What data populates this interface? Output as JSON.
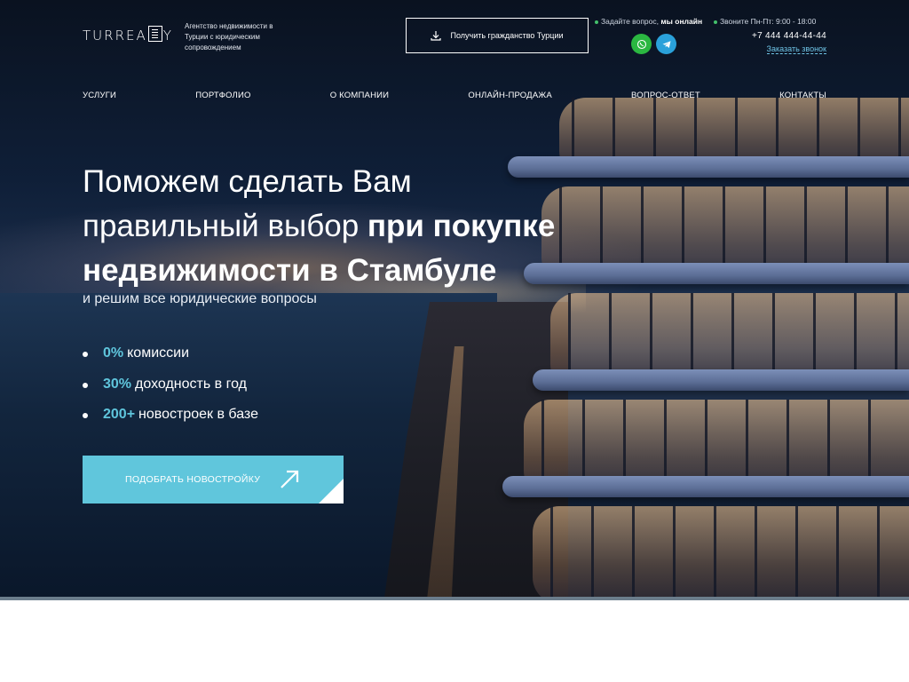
{
  "brand": {
    "logo_left": "TURREA",
    "logo_right": "Y",
    "tagline": "Агентство недвижимости в Турции с юридическим сопровождением"
  },
  "header": {
    "citizenship_button": "Получить гражданство Турции",
    "ask_prefix": "Задайте вопрос,",
    "ask_bold": "мы онлайн",
    "hours": "Звоните Пн-Пт: 9:00 - 18:00",
    "phone": "+7 444 444-44-44",
    "callback": "Заказать звонок",
    "whatsapp_icon": "whatsapp-icon",
    "telegram_icon": "telegram-icon"
  },
  "nav": {
    "items": [
      "УСЛУГИ",
      "ПОРТФОЛИО",
      "О КОМПАНИИ",
      "ОНЛАЙН-ПРОДАЖА",
      "ВОПРОС-ОТВЕТ",
      "КОНТАКТЫ"
    ]
  },
  "hero": {
    "headline_light": "Поможем сделать Вам правильный выбор",
    "headline_bold": "при покупке недвижимости в Стамбуле",
    "subheadline": "и решим все юридические вопросы",
    "benefits": [
      {
        "value": "0%",
        "text": "комиссии"
      },
      {
        "value": "30%",
        "text": "доходность в год"
      },
      {
        "value": "200+",
        "text": "новостроек в базе"
      }
    ],
    "cta_label": "ПОДОБРАТЬ НОВОСТРОЙКУ"
  },
  "colors": {
    "accent": "#60c6dc",
    "whatsapp": "#2bb741",
    "telegram": "#2aa1da",
    "online_dot": "#43c06b"
  }
}
